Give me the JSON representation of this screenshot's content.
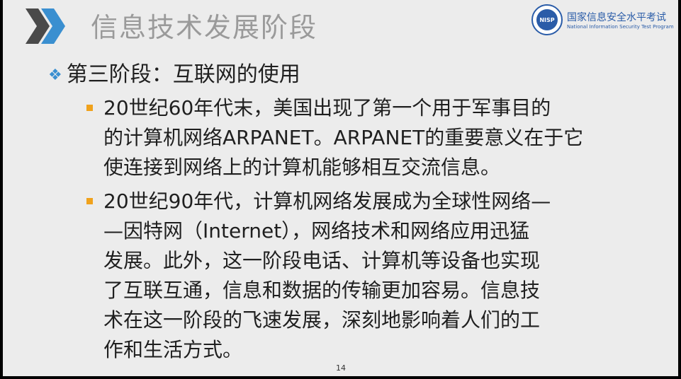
{
  "header": {
    "title": "信息技术发展阶段",
    "logo_cn": "国家信息安全水平考试",
    "logo_en": "National Information Security Test Program",
    "logo_badge": "NISP"
  },
  "content": {
    "level1": "第三阶段：互联网的使用",
    "bullets": [
      {
        "lines": [
          "20世纪60年代末，美国出现了第一个用于军事目的",
          "的计算机网络ARPANET。ARPANET的重要意义在于它",
          "使连接到网络上的计算机能够相互交流信息。"
        ]
      },
      {
        "lines": [
          "20世纪90年代，计算机网络发展成为全球性网络—",
          "—因特网（Internet），网络技术和网络应用迅猛",
          "发展。此外，这一阶段电话、计算机等设备也实现",
          "了互联互通，信息和数据的传输更加容易。信息技",
          "术在这一阶段的飞速发展，深刻地影响着人们的工",
          "作和生活方式。"
        ]
      }
    ]
  },
  "footer": {
    "page_number": "14"
  },
  "colors": {
    "accent_blue": "#3a8fd0",
    "bullet_orange": "#f0a21c",
    "title_gray": "#9a9a9a"
  }
}
